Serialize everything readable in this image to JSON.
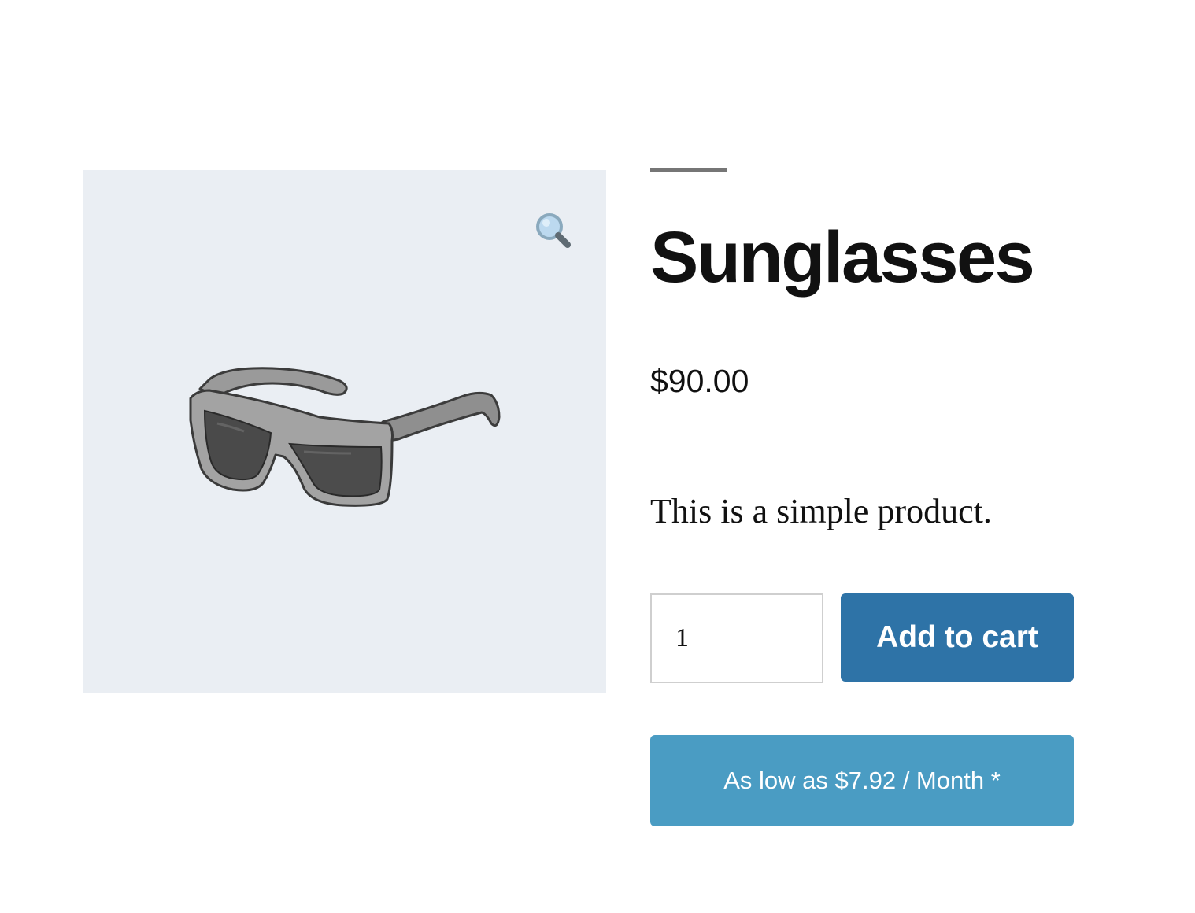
{
  "product": {
    "title": "Sunglasses",
    "price": "$90.00",
    "description": "This is a simple product.",
    "image_icon": "sunglasses-product-image"
  },
  "gallery": {
    "zoom_icon": "magnifying-glass-icon"
  },
  "cart_form": {
    "quantity_value": "1",
    "add_to_cart_label": "Add to cart"
  },
  "financing": {
    "label": "As low as $7.92 / Month *"
  },
  "colors": {
    "primary_button": "#2e73a7",
    "financing_button": "#4a9cc3",
    "gallery_background": "#eaeef3"
  }
}
